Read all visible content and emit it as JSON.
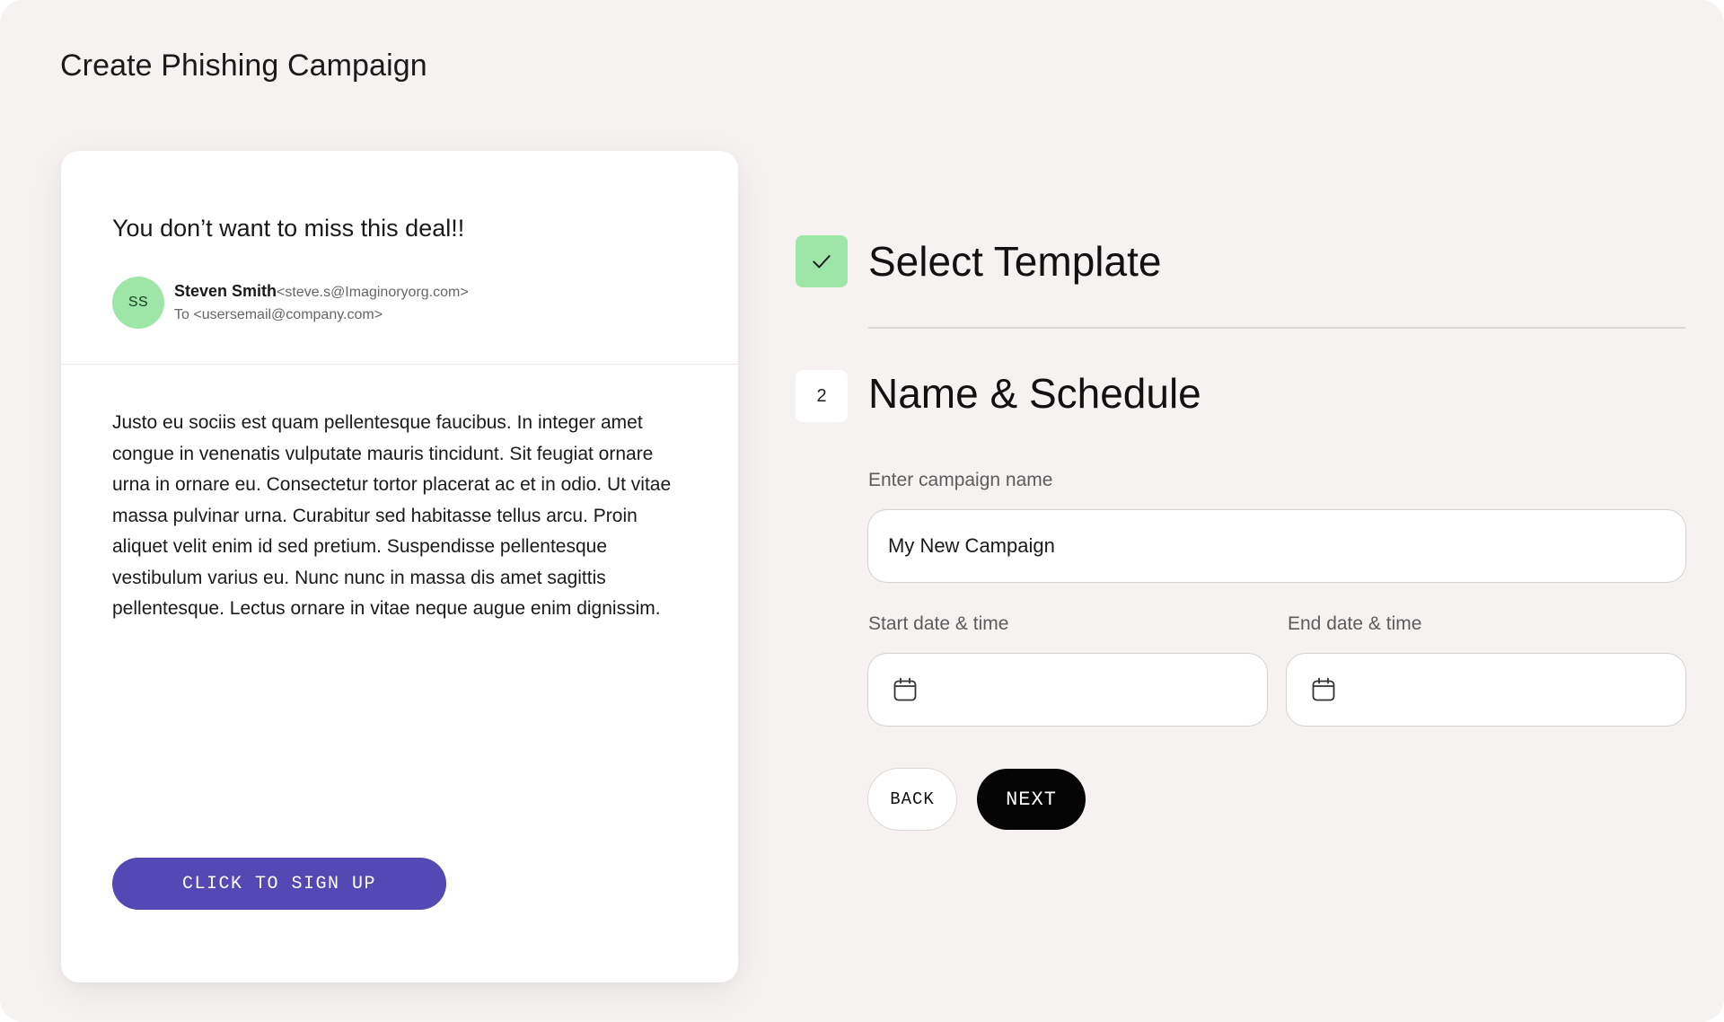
{
  "page": {
    "title": "Create Phishing Campaign"
  },
  "email": {
    "subject": "You don’t want to miss this deal!!",
    "avatar_initials": "SS",
    "sender_name": "Steven Smith",
    "sender_email": "<steve.s@Imaginoryorg.com>",
    "recipient": "To <usersemail@company.com>",
    "body": "Justo eu sociis est quam pellentesque faucibus. In integer amet congue in venenatis vulputate mauris tincidunt. Sit feugiat ornare urna in ornare eu. Consectetur tortor placerat ac et in odio. Ut vitae massa pulvinar urna. Curabitur sed habitasse tellus arcu. Proin aliquet velit enim id sed pretium. Suspendisse pellentesque vestibulum varius eu. Nunc nunc in massa dis amet sagittis pellentesque. Lectus ornare in vitae neque augue enim dignissim.",
    "cta_label": "CLICK TO SIGN UP"
  },
  "steps": [
    {
      "status": "complete",
      "icon": "check-icon",
      "title": "Select Template"
    },
    {
      "status": "active",
      "number": "2",
      "title": "Name & Schedule"
    }
  ],
  "form": {
    "campaign_name_label": "Enter campaign name",
    "campaign_name_value": "My New Campaign",
    "start_label": "Start date & time",
    "start_value": "",
    "end_label": "End date & time",
    "end_value": "",
    "date_icon": "calendar-icon"
  },
  "actions": {
    "back_label": "BACK",
    "next_label": "NEXT"
  },
  "colors": {
    "background": "#f5f2f1",
    "accent_green": "#9ee6a7",
    "cta_purple": "#5448b5",
    "next_black": "#050505"
  }
}
